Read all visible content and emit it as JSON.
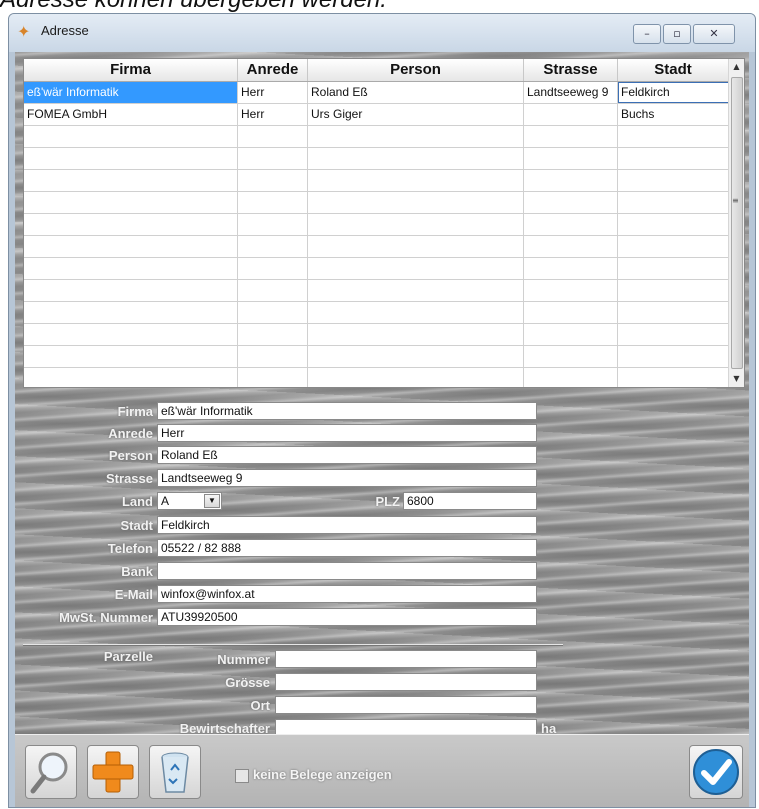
{
  "caption": "Adresse können übergeben werden.",
  "window": {
    "title": "Adresse",
    "minimize": "–",
    "maximize": "▫",
    "close": "✕"
  },
  "grid": {
    "columns": [
      "Firma",
      "Anrede",
      "Person",
      "Strasse",
      "Stadt"
    ],
    "rows": [
      [
        "eß'wär Informatik",
        "Herr",
        "Roland Eß",
        "Landtseeweg 9",
        "Feldkirch"
      ],
      [
        "FOMEA GmbH",
        "Herr",
        "Urs Giger",
        "",
        "Buchs"
      ]
    ],
    "selected_row": 0
  },
  "form": {
    "firma": {
      "label": "Firma",
      "value": "eß'wär Informatik"
    },
    "anrede": {
      "label": "Anrede",
      "value": "Herr"
    },
    "person": {
      "label": "Person",
      "value": "Roland Eß"
    },
    "strasse": {
      "label": "Strasse",
      "value": "Landtseeweg 9"
    },
    "land": {
      "label": "Land",
      "value": "A"
    },
    "plz": {
      "label": "PLZ",
      "value": "6800"
    },
    "stadt": {
      "label": "Stadt",
      "value": "Feldkirch"
    },
    "telefon": {
      "label": "Telefon",
      "value": "05522 / 82 888"
    },
    "bank": {
      "label": "Bank",
      "value": ""
    },
    "email": {
      "label": "E-Mail",
      "value": "winfox@winfox.at"
    },
    "mwst": {
      "label": "MwSt. Nummer",
      "value": "ATU39920500"
    },
    "parzelle": {
      "label": "Parzelle"
    },
    "nummer": {
      "label": "Nummer",
      "value": ""
    },
    "groesse": {
      "label": "Grösse",
      "value": ""
    },
    "ort": {
      "label": "Ort",
      "value": ""
    },
    "bewirtschafter": {
      "label": "Bewirtschafter",
      "value": ""
    },
    "ha_unit": "ha"
  },
  "toolbar": {
    "search_icon": "magnifier-icon",
    "add_icon": "plus-icon",
    "delete_icon": "recycle-bin-icon",
    "ok_icon": "checkmark-icon",
    "checkbox_label": "keine Belege anzeigen",
    "checkbox_checked": false
  },
  "colors": {
    "selection": "#3399ff",
    "label_text": "#f2f2f2",
    "add_orange": "#f08a1c",
    "ok_blue": "#2f8fd8"
  }
}
